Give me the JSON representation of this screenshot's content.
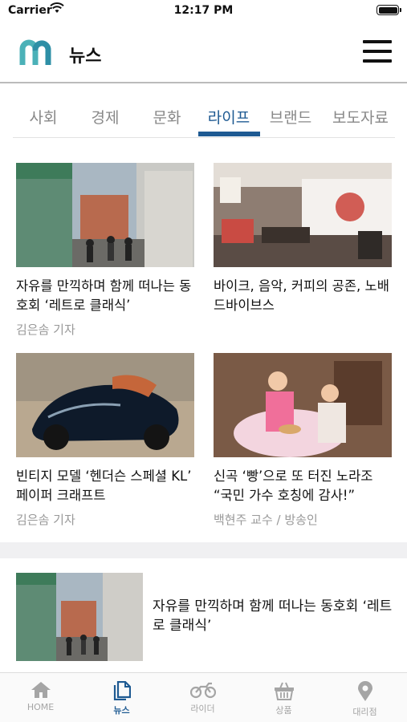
{
  "status_bar": {
    "carrier": "Carrier",
    "time": "12:17 PM"
  },
  "header": {
    "title": "뉴스",
    "logo_icon": "m-logo-icon",
    "menu_icon": "hamburger-menu-icon"
  },
  "tabs": [
    {
      "label": "사회"
    },
    {
      "label": "경제"
    },
    {
      "label": "문화"
    },
    {
      "label": "라이프",
      "active": true
    },
    {
      "label": "브랜드"
    },
    {
      "label": "보도자료"
    }
  ],
  "cards": [
    {
      "title": "자유를 만끽하며 함께 떠나는 동호회 ‘레트로 클래식’",
      "byline": "김은솜 기자"
    },
    {
      "title": "바이크, 음악, 커피의 공존, 노배드바이브스",
      "byline": ""
    },
    {
      "title": "빈티지 모델 ‘헨더슨 스페셜 KL’ 페이퍼 크래프트",
      "byline": "김은솜 기자"
    },
    {
      "title": "신곡 ‘빵’으로 또 터진 노라조 “국민 가수 호칭에 감사!”",
      "byline": "백현주 교수 / 방송인"
    }
  ],
  "list_item": {
    "title": "자유를 만끽하며 함께 떠나는 동호회 ‘레트로 클래식’"
  },
  "bottom_nav": [
    {
      "label": "HOME",
      "icon": "home-icon"
    },
    {
      "label": "뉴스",
      "icon": "news-icon",
      "active": true
    },
    {
      "label": "라이더",
      "icon": "motorcycle-icon"
    },
    {
      "label": "상품",
      "icon": "shopping-basket-icon"
    },
    {
      "label": "대리점",
      "icon": "location-pin-icon"
    }
  ],
  "colors": {
    "accent": "#1e5a92",
    "logo_teal": "#4bb1b8",
    "inactive": "#a5a5a5"
  }
}
